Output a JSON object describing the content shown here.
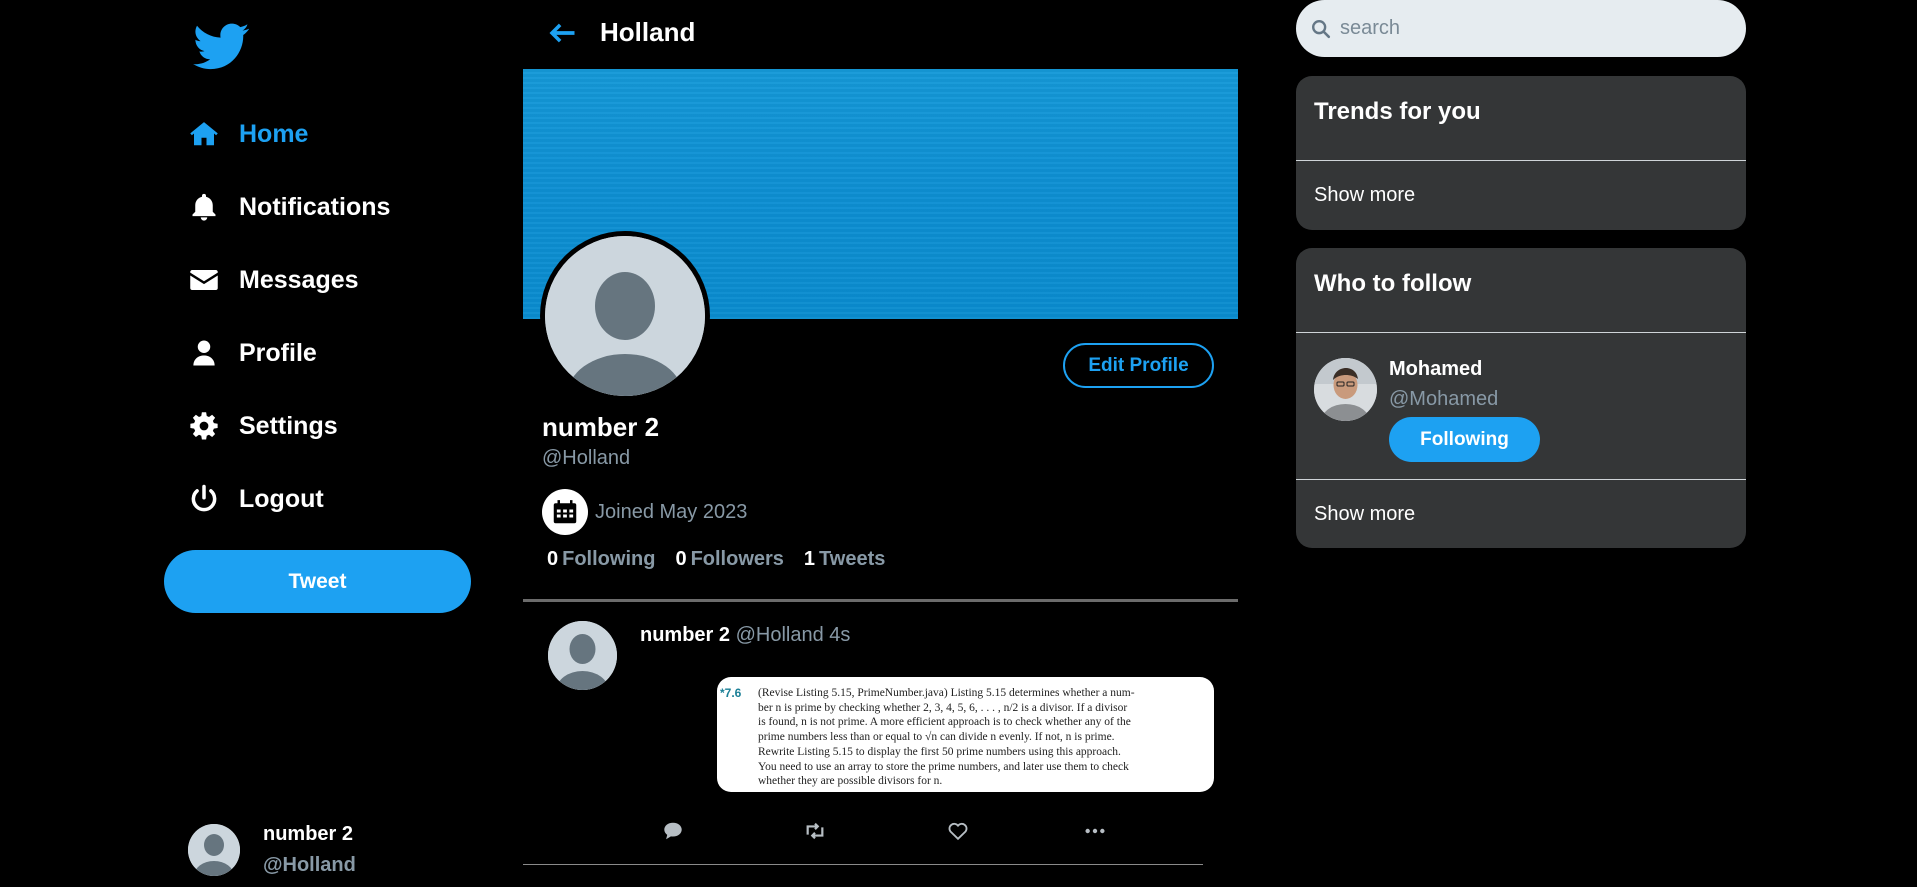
{
  "colors": {
    "accent": "#1da1f2",
    "muted": "#8899a6",
    "panel": "#343637",
    "banner": "#0d8fd3"
  },
  "sidebar": {
    "logo_icon": "twitter-bird-icon",
    "nav": [
      {
        "label": "Home",
        "icon": "home-icon",
        "active": true
      },
      {
        "label": "Notifications",
        "icon": "bell-icon",
        "active": false
      },
      {
        "label": "Messages",
        "icon": "envelope-icon",
        "active": false
      },
      {
        "label": "Profile",
        "icon": "user-icon",
        "active": false
      },
      {
        "label": "Settings",
        "icon": "gear-icon",
        "active": false
      },
      {
        "label": "Logout",
        "icon": "power-icon",
        "active": false
      }
    ],
    "tweet_button": "Tweet",
    "account": {
      "name": "number 2",
      "handle": "@Holland"
    }
  },
  "header": {
    "title": "Holland",
    "back_icon": "arrow-left-icon"
  },
  "profile": {
    "name": "number 2",
    "handle": "@Holland",
    "joined": "Joined May 2023",
    "edit_button": "Edit Profile",
    "stats": [
      {
        "count": "0",
        "label": "Following"
      },
      {
        "count": "0",
        "label": "Followers"
      },
      {
        "count": "1",
        "label": "Tweets"
      }
    ]
  },
  "tweet": {
    "name": "number 2",
    "meta": "@Holland 4s",
    "media": {
      "number": "*7.6",
      "lines": [
        "(Revise Listing 5.15, PrimeNumber.java) Listing 5.15 determines whether a num-",
        "ber n is prime by checking whether 2, 3, 4, 5, 6, . . . , n/2 is a divisor. If a divisor",
        "is found, n is not prime. A more efficient approach is to check whether any of the",
        "prime numbers less than or equal to √n can divide n evenly. If not, n is prime.",
        "Rewrite Listing 5.15 to display the first 50 prime numbers using this approach.",
        "You need to use an array to store the prime numbers, and later use them to check",
        "whether they are possible divisors for n."
      ]
    },
    "actions": [
      "comment-icon",
      "retweet-icon",
      "heart-icon",
      "more-icon"
    ]
  },
  "right": {
    "search_placeholder": "search",
    "trends": {
      "title": "Trends for you",
      "more": "Show more"
    },
    "who_to_follow": {
      "title": "Who to follow",
      "users": [
        {
          "name": "Mohamed",
          "handle": "@Mohamed",
          "button": "Following"
        }
      ],
      "more": "Show more"
    }
  }
}
